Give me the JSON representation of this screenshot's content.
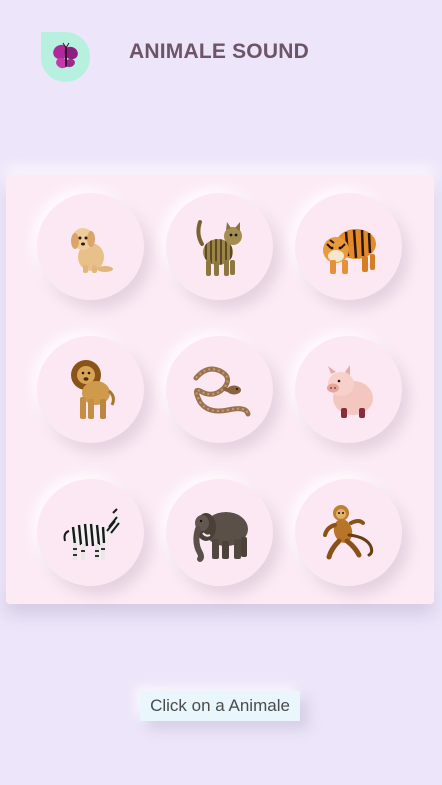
{
  "header": {
    "title": "ANIMALE SOUND",
    "logo_icon": "butterfly-icon"
  },
  "board": {
    "animals": [
      {
        "name": "dog",
        "icon": "dog-icon"
      },
      {
        "name": "cat",
        "icon": "cat-icon"
      },
      {
        "name": "tiger",
        "icon": "tiger-icon"
      },
      {
        "name": "lion",
        "icon": "lion-icon"
      },
      {
        "name": "snake",
        "icon": "snake-icon"
      },
      {
        "name": "pig",
        "icon": "pig-icon"
      },
      {
        "name": "zebra",
        "icon": "zebra-icon"
      },
      {
        "name": "elephant",
        "icon": "elephant-icon"
      },
      {
        "name": "monkey",
        "icon": "monkey-icon"
      }
    ]
  },
  "status": {
    "text": "Click on a Animale"
  },
  "colors": {
    "background": "#ede6fa",
    "board": "#fcebf5",
    "logo_bg": "#b7f0df",
    "title": "#6d5567",
    "status_bg": "#e9f6fb"
  }
}
